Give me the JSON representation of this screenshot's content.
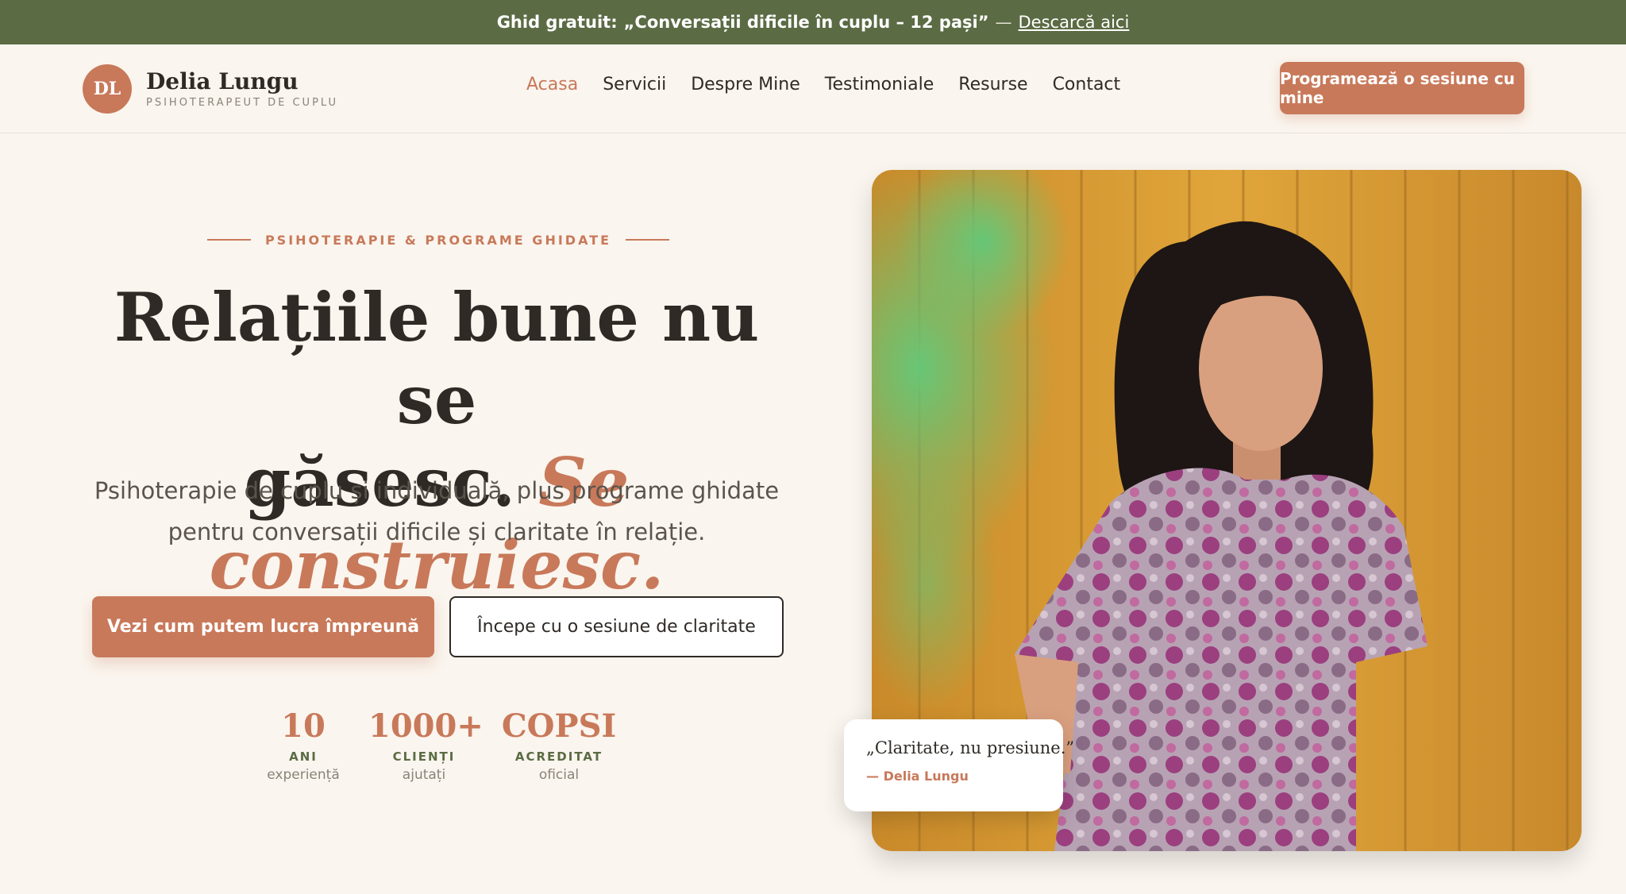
{
  "announcement": {
    "prefix": "Ghid gratuit:",
    "guide_title": "„Conversații dificile în cuplu – 12 pași”",
    "separator": "—",
    "link": "Descarcă aici"
  },
  "header": {
    "logo_initials": "DL",
    "brand_name": "Delia Lungu",
    "brand_subtitle": "PSIHOTERAPEUT DE CUPLU",
    "nav": [
      {
        "label": "Acasa"
      },
      {
        "label": "Servicii"
      },
      {
        "label": "Despre Mine"
      },
      {
        "label": "Testimoniale"
      },
      {
        "label": "Resurse"
      },
      {
        "label": "Contact"
      }
    ],
    "active_nav": "Acasa",
    "cta": "Programează o sesiune cu mine"
  },
  "hero": {
    "eyebrow": "PSIHOTERAPIE & PROGRAME GHIDATE",
    "title_line1": "Relațiile bune nu se",
    "title_line2_plain": "găsesc.",
    "title_line2_accent": "Se construiesc.",
    "description": "Psihoterapie de cuplu și individuală, plus programe ghidate pentru conversații dificile și claritate în relație.",
    "primary_button": "Vezi cum putem lucra împreună",
    "secondary_button": "Începe cu o sesiune de claritate",
    "stats": [
      {
        "value": "10",
        "label": "ANI",
        "sub": "experiență"
      },
      {
        "value": "1000+",
        "label": "CLIENȚI",
        "sub": "ajutați"
      },
      {
        "value": "COPSI",
        "label": "ACREDITAT",
        "sub": "oficial"
      }
    ]
  },
  "quote": {
    "text": "„Claritate, nu presiune.”",
    "author": "— Delia Lungu"
  },
  "colors": {
    "accent": "#c8795a",
    "announcement_bg": "#5b6b44",
    "page_bg": "#faf5ee",
    "text_dark": "#2f2a26"
  }
}
